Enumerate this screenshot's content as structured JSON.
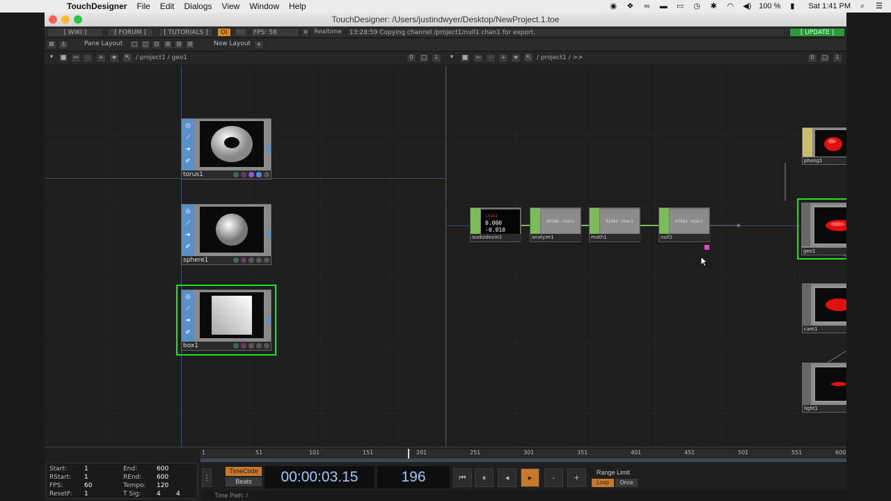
{
  "menubar": {
    "app_name": "TouchDesigner",
    "items": [
      "File",
      "Edit",
      "Dialogs",
      "View",
      "Window",
      "Help"
    ],
    "battery": "100 %",
    "clock": "Sat 1:41 PM"
  },
  "window": {
    "title": "TouchDesigner: /Users/justindwyer/Desktop/NewProject.1.toe"
  },
  "toolbar": {
    "wiki": "[ WIKI ]",
    "forum": "[ FORUM ]",
    "tutorials": "[ TUTORIALS ]",
    "oi": "OI",
    "sixty": "60",
    "fps": "FPS:  58",
    "realtime": "Realtime",
    "status": "13:28:59 Copying channel /project1/null1 chan1 for export.",
    "update": "[ UPDATE ]",
    "pane_layout": "Pane Layout",
    "new_layout": "New Layout"
  },
  "left_pane": {
    "path": "/ project1 / geo1",
    "counter": "0",
    "nodes": [
      "torus1",
      "sphere1",
      "box1"
    ]
  },
  "right_pane": {
    "path": "/ project1 / >>",
    "counter": "0",
    "chops": [
      {
        "name": "audiodevin1",
        "view_top": "chan1",
        "v1": "0.000",
        "v2": "-0.010"
      },
      {
        "name": "analyze1",
        "view": "00286 chan1"
      },
      {
        "name": "math1",
        "view": "01061 chan1"
      },
      {
        "name": "null1",
        "view": "01061 chan1"
      }
    ],
    "comps": [
      "phong1",
      "geo1",
      "cam1",
      "light1"
    ]
  },
  "timeline": {
    "ruler": [
      "1",
      "51",
      "101",
      "151",
      "201",
      "251",
      "301",
      "351",
      "401",
      "451",
      "501",
      "551",
      "600"
    ],
    "playhead_frame": 196,
    "range_start_frame": 1,
    "range_end_frame": 600,
    "start_label": "Start:",
    "start": "1",
    "rstart_label": "RStart:",
    "rstart": "1",
    "fps_label": "FPS:",
    "fps": "60",
    "resetf_label": "ResetF:",
    "resetf": "1",
    "end_label": "End:",
    "end": "600",
    "rend_label": "REnd:",
    "rend": "600",
    "tempo_label": "Tempo:",
    "tempo": "120",
    "tsig_label": "T Sig:",
    "tsig1": "4",
    "tsig2": "4",
    "timecode_btn": "TimeCode",
    "beats_btn": "Beats",
    "timecode": "00:00:03.15",
    "frame": "196",
    "range_limit": "Range Limit",
    "loop": "Loop",
    "once": "Once",
    "time_path": "Time Path: /"
  }
}
